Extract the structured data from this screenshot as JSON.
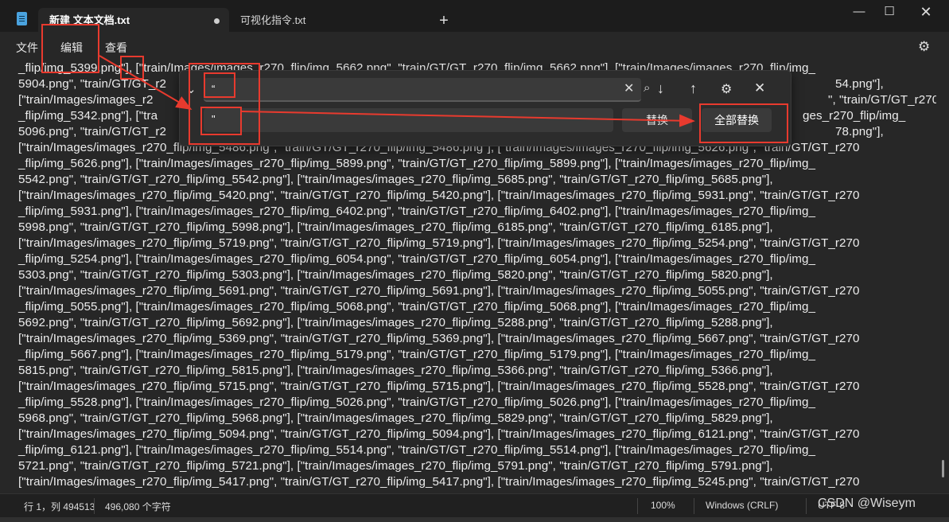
{
  "tabs": [
    {
      "label": "新建 文本文档.txt"
    },
    {
      "label": "可视化指令.txt"
    }
  ],
  "new_tab": "+",
  "window_controls": {
    "minimize": "—",
    "maximize": "☐",
    "close": "✕"
  },
  "menu": {
    "file": "文件",
    "edit": "编辑",
    "view": "查看"
  },
  "lines": [
    "_flip/img_5399.png\"], [\"train/Images/images_r270_flip/img_5662.png\", \"train/GT/GT_r270_flip/img_5662.png\"], [\"train/Images/images_r270_flip/img_",
    "5904.png\", \"train/GT/GT_r2",
    "[\"train/Images/images_r2",
    "_flip/img_5342.png\"], [\"tra",
    "5096.png\", \"train/GT/GT_r2",
    "[\"train/Images/images_r270_flip/img_5486.png\", \"train/GT/GT_r270_flip/img_5486.png\"], [\"train/Images/images_r270_flip/img_5626.png\", \"train/GT/GT_r270",
    "_flip/img_5626.png\"], [\"train/Images/images_r270_flip/img_5899.png\", \"train/GT/GT_r270_flip/img_5899.png\"], [\"train/Images/images_r270_flip/img_",
    "5542.png\", \"train/GT/GT_r270_flip/img_5542.png\"], [\"train/Images/images_r270_flip/img_5685.png\", \"train/GT/GT_r270_flip/img_5685.png\"],",
    "[\"train/Images/images_r270_flip/img_5420.png\", \"train/GT/GT_r270_flip/img_5420.png\"], [\"train/Images/images_r270_flip/img_5931.png\", \"train/GT/GT_r270",
    "_flip/img_5931.png\"], [\"train/Images/images_r270_flip/img_6402.png\", \"train/GT/GT_r270_flip/img_6402.png\"], [\"train/Images/images_r270_flip/img_",
    "5998.png\", \"train/GT/GT_r270_flip/img_5998.png\"], [\"train/Images/images_r270_flip/img_6185.png\", \"train/GT/GT_r270_flip/img_6185.png\"],",
    "[\"train/Images/images_r270_flip/img_5719.png\", \"train/GT/GT_r270_flip/img_5719.png\"], [\"train/Images/images_r270_flip/img_5254.png\", \"train/GT/GT_r270",
    "_flip/img_5254.png\"], [\"train/Images/images_r270_flip/img_6054.png\", \"train/GT/GT_r270_flip/img_6054.png\"], [\"train/Images/images_r270_flip/img_",
    "5303.png\", \"train/GT/GT_r270_flip/img_5303.png\"], [\"train/Images/images_r270_flip/img_5820.png\", \"train/GT/GT_r270_flip/img_5820.png\"],",
    "[\"train/Images/images_r270_flip/img_5691.png\", \"train/GT/GT_r270_flip/img_5691.png\"], [\"train/Images/images_r270_flip/img_5055.png\", \"train/GT/GT_r270",
    "_flip/img_5055.png\"], [\"train/Images/images_r270_flip/img_5068.png\", \"train/GT/GT_r270_flip/img_5068.png\"], [\"train/Images/images_r270_flip/img_",
    "5692.png\", \"train/GT/GT_r270_flip/img_5692.png\"], [\"train/Images/images_r270_flip/img_5288.png\", \"train/GT/GT_r270_flip/img_5288.png\"],",
    "[\"train/Images/images_r270_flip/img_5369.png\", \"train/GT/GT_r270_flip/img_5369.png\"], [\"train/Images/images_r270_flip/img_5667.png\", \"train/GT/GT_r270",
    "_flip/img_5667.png\"], [\"train/Images/images_r270_flip/img_5179.png\", \"train/GT/GT_r270_flip/img_5179.png\"], [\"train/Images/images_r270_flip/img_",
    "5815.png\", \"train/GT/GT_r270_flip/img_5815.png\"], [\"train/Images/images_r270_flip/img_5366.png\", \"train/GT/GT_r270_flip/img_5366.png\"],",
    "[\"train/Images/images_r270_flip/img_5715.png\", \"train/GT/GT_r270_flip/img_5715.png\"], [\"train/Images/images_r270_flip/img_5528.png\", \"train/GT/GT_r270",
    "_flip/img_5528.png\"], [\"train/Images/images_r270_flip/img_5026.png\", \"train/GT/GT_r270_flip/img_5026.png\"], [\"train/Images/images_r270_flip/img_",
    "5968.png\", \"train/GT/GT_r270_flip/img_5968.png\"], [\"train/Images/images_r270_flip/img_5829.png\", \"train/GT/GT_r270_flip/img_5829.png\"],",
    "[\"train/Images/images_r270_flip/img_5094.png\", \"train/GT/GT_r270_flip/img_5094.png\"], [\"train/Images/images_r270_flip/img_6121.png\", \"train/GT/GT_r270",
    "_flip/img_6121.png\"], [\"train/Images/images_r270_flip/img_5514.png\", \"train/GT/GT_r270_flip/img_5514.png\"], [\"train/Images/images_r270_flip/img_",
    "5721.png\", \"train/GT/GT_r270_flip/img_5721.png\"], [\"train/Images/images_r270_flip/img_5791.png\", \"train/GT/GT_r270_flip/img_5791.png\"],",
    "[\"train/Images/images_r270_flip/img_5417.png\", \"train/GT/GT_r270_flip/img_5417.png\"], [\"train/Images/images_r270_flip/img_5245.png\", \"train/GT/GT_r270"
  ],
  "line_tails": [
    {
      "line": 1,
      "text": "54.png\"],"
    },
    {
      "line": 2,
      "text": "\", \"train/GT/GT_r270"
    },
    {
      "line": 3,
      "text": "ges_r270_flip/img_"
    },
    {
      "line": 4,
      "text": "78.png\"],"
    }
  ],
  "find": {
    "value": "“",
    "clear_icon": "✕",
    "search_icon": "⌕",
    "next_icon": "↓",
    "prev_icon": "↑",
    "options_icon": "⚙",
    "close_icon": "✕",
    "chevron_icon": "⌄"
  },
  "replace": {
    "value": "\"",
    "replace_label": "替换",
    "replace_all_label": "全部替换"
  },
  "status": {
    "position": "行 1，列 494513",
    "char_count": "496,080 个字符",
    "zoom": "100%",
    "line_ending": "Windows (CRLF)",
    "encoding": "UTF-8"
  },
  "watermark": "CSDN @Wiseym",
  "annotation_color": "#e83a2e"
}
